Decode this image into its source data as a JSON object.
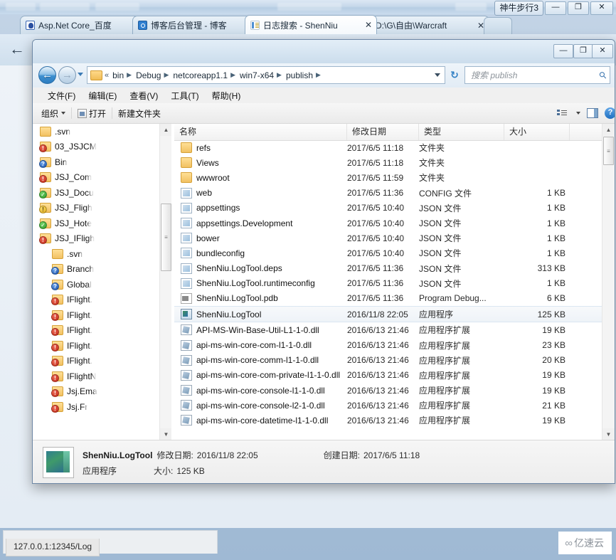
{
  "browser": {
    "window_label": "神牛步行3",
    "controls": {
      "minimize": "—",
      "maximize": "❐",
      "close": "✕"
    },
    "tabs": [
      {
        "label": "Asp.Net Core_百度",
        "close": "✕",
        "favicon": "baidu-icon",
        "active": false
      },
      {
        "label": "博客后台管理 - 博客",
        "close": "✕",
        "favicon": "blog-icon",
        "active": false
      },
      {
        "label": "日志搜索 - ShenNiu",
        "close": "✕",
        "favicon": "document-icon",
        "active": true
      },
      {
        "label": "D:\\G\\自由\\Warcraft",
        "close": "✕",
        "favicon": "document-icon",
        "active": false
      }
    ],
    "back_arrow": "←",
    "status_url": "127.0.0.1:12345/Log",
    "watermark": {
      "glyph": "∞",
      "text": "亿速云"
    }
  },
  "explorer": {
    "controls": {
      "minimize": "—",
      "maximize": "❐",
      "close": "✕"
    },
    "nav": {
      "back": "←",
      "forward": "→",
      "refresh": "↻"
    },
    "breadcrumb": {
      "prefix": "«",
      "items": [
        "bin",
        "Debug",
        "netcoreapp1.1",
        "win7-x64",
        "publish"
      ],
      "separator": "▶"
    },
    "search": {
      "placeholder": "搜索 publish",
      "icon": "search-icon"
    },
    "menubar": [
      "文件(F)",
      "编辑(E)",
      "查看(V)",
      "工具(T)",
      "帮助(H)"
    ],
    "toolbar": {
      "organize": "组织",
      "open": "打开",
      "new_folder": "新建文件夹",
      "view_icon": "view-layout-icon",
      "pane_icon": "preview-pane-icon",
      "help_icon": "help-icon"
    },
    "nav_pane": [
      {
        "label": ".svn",
        "icon": "folder-icon",
        "overlay": "none",
        "indent": 0
      },
      {
        "label": "03_JSJCM",
        "icon": "folder-icon",
        "overlay": "red",
        "indent": 0
      },
      {
        "label": "Bin",
        "icon": "folder-icon",
        "overlay": "blue",
        "indent": 0
      },
      {
        "label": "JSJ_Com",
        "icon": "folder-icon",
        "overlay": "red",
        "indent": 0
      },
      {
        "label": "JSJ_Docu",
        "icon": "folder-icon",
        "overlay": "green",
        "indent": 0
      },
      {
        "label": "JSJ_Fligh",
        "icon": "folder-icon",
        "overlay": "yellow",
        "indent": 0
      },
      {
        "label": "JSJ_Hote",
        "icon": "folder-icon",
        "overlay": "green",
        "indent": 0
      },
      {
        "label": "JSJ_IFligh",
        "icon": "folder-icon",
        "overlay": "red",
        "indent": 0
      },
      {
        "label": ".svn",
        "icon": "folder-icon",
        "overlay": "none",
        "indent": 1
      },
      {
        "label": "Branch",
        "icon": "folder-icon",
        "overlay": "blue",
        "indent": 1
      },
      {
        "label": "Global",
        "icon": "folder-icon",
        "overlay": "blue",
        "indent": 1
      },
      {
        "label": "IFlight.",
        "icon": "folder-icon",
        "overlay": "red",
        "indent": 1
      },
      {
        "label": "IFlight.",
        "icon": "folder-icon",
        "overlay": "red",
        "indent": 1
      },
      {
        "label": "IFlight.",
        "icon": "folder-icon",
        "overlay": "red",
        "indent": 1
      },
      {
        "label": "IFlight.",
        "icon": "folder-icon",
        "overlay": "red",
        "indent": 1
      },
      {
        "label": "IFlight.",
        "icon": "folder-icon",
        "overlay": "red",
        "indent": 1
      },
      {
        "label": "IFlightN",
        "icon": "folder-icon",
        "overlay": "red",
        "indent": 1
      },
      {
        "label": "Jsj.Ema",
        "icon": "folder-icon",
        "overlay": "red",
        "indent": 1
      },
      {
        "label": "Jsj.Fr",
        "icon": "folder-icon",
        "overlay": "red",
        "indent": 1
      }
    ],
    "columns": [
      "名称",
      "修改日期",
      "类型",
      "大小"
    ],
    "files": [
      {
        "name": "refs",
        "date": "2017/6/5 11:18",
        "type": "文件夹",
        "size": "",
        "icon": "folder-icon"
      },
      {
        "name": "Views",
        "date": "2017/6/5 11:18",
        "type": "文件夹",
        "size": "",
        "icon": "folder-icon"
      },
      {
        "name": "wwwroot",
        "date": "2017/6/5 11:59",
        "type": "文件夹",
        "size": "",
        "icon": "folder-icon"
      },
      {
        "name": "web",
        "date": "2017/6/5 11:36",
        "type": "CONFIG 文件",
        "size": "1 KB",
        "icon": "file-icon"
      },
      {
        "name": "appsettings",
        "date": "2017/6/5 10:40",
        "type": "JSON 文件",
        "size": "1 KB",
        "icon": "file-icon"
      },
      {
        "name": "appsettings.Development",
        "date": "2017/6/5 10:40",
        "type": "JSON 文件",
        "size": "1 KB",
        "icon": "file-icon"
      },
      {
        "name": "bower",
        "date": "2017/6/5 10:40",
        "type": "JSON 文件",
        "size": "1 KB",
        "icon": "file-icon"
      },
      {
        "name": "bundleconfig",
        "date": "2017/6/5 10:40",
        "type": "JSON 文件",
        "size": "1 KB",
        "icon": "file-icon"
      },
      {
        "name": "ShenNiu.LogTool.deps",
        "date": "2017/6/5 11:36",
        "type": "JSON 文件",
        "size": "313 KB",
        "icon": "file-icon"
      },
      {
        "name": "ShenNiu.LogTool.runtimeconfig",
        "date": "2017/6/5 11:36",
        "type": "JSON 文件",
        "size": "1 KB",
        "icon": "file-icon"
      },
      {
        "name": "ShenNiu.LogTool.pdb",
        "date": "2017/6/5 11:36",
        "type": "Program Debug...",
        "size": "6 KB",
        "icon": "pdb-icon"
      },
      {
        "name": "ShenNiu.LogTool",
        "date": "2016/11/8 22:05",
        "type": "应用程序",
        "size": "125 KB",
        "icon": "exe-icon",
        "selected": true
      },
      {
        "name": "API-MS-Win-Base-Util-L1-1-0.dll",
        "date": "2016/6/13 21:46",
        "type": "应用程序扩展",
        "size": "19 KB",
        "icon": "dll-icon"
      },
      {
        "name": "api-ms-win-core-com-l1-1-0.dll",
        "date": "2016/6/13 21:46",
        "type": "应用程序扩展",
        "size": "23 KB",
        "icon": "dll-icon"
      },
      {
        "name": "api-ms-win-core-comm-l1-1-0.dll",
        "date": "2016/6/13 21:46",
        "type": "应用程序扩展",
        "size": "20 KB",
        "icon": "dll-icon"
      },
      {
        "name": "api-ms-win-core-com-private-l1-1-0.dll",
        "date": "2016/6/13 21:46",
        "type": "应用程序扩展",
        "size": "19 KB",
        "icon": "dll-icon"
      },
      {
        "name": "api-ms-win-core-console-l1-1-0.dll",
        "date": "2016/6/13 21:46",
        "type": "应用程序扩展",
        "size": "19 KB",
        "icon": "dll-icon"
      },
      {
        "name": "api-ms-win-core-console-l2-1-0.dll",
        "date": "2016/6/13 21:46",
        "type": "应用程序扩展",
        "size": "21 KB",
        "icon": "dll-icon"
      },
      {
        "name": "api-ms-win-core-datetime-l1-1-0.dll",
        "date": "2016/6/13 21:46",
        "type": "应用程序扩展",
        "size": "19 KB",
        "icon": "dll-icon"
      }
    ],
    "details": {
      "name": "ShenNiu.LogTool",
      "modified_label": "修改日期:",
      "modified_value": "2016/11/8 22:05",
      "created_label": "创建日期:",
      "created_value": "2017/6/5 11:18",
      "type": "应用程序",
      "size_label": "大小:",
      "size_value": "125 KB"
    }
  }
}
